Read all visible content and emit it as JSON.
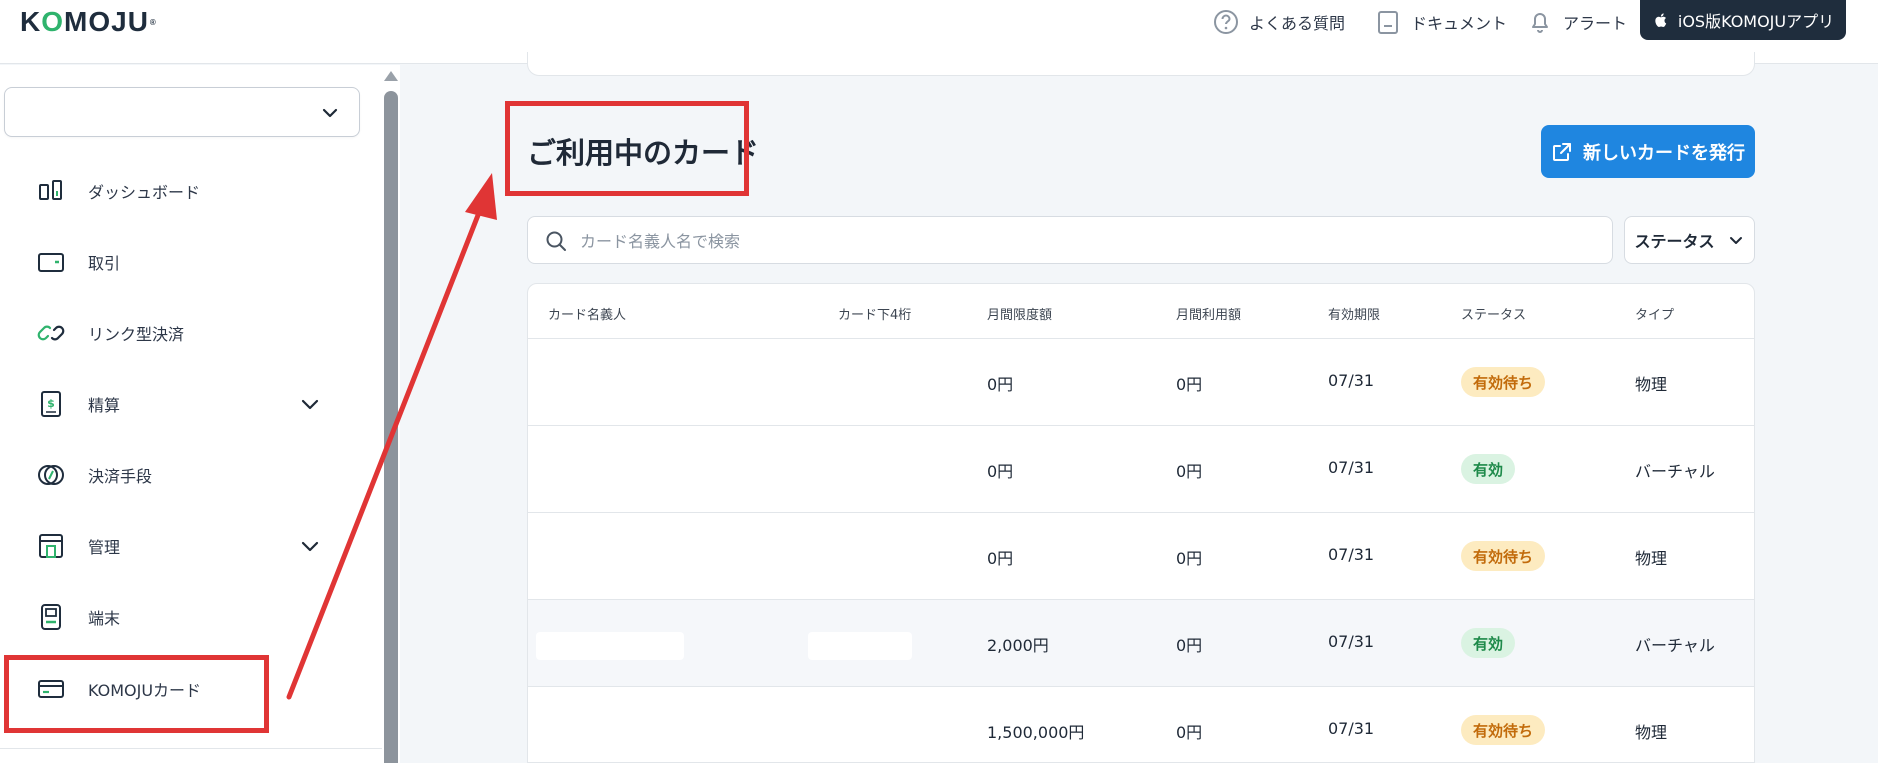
{
  "header": {
    "logo": "KOMOJU",
    "faq": "よくある質問",
    "docs": "ドキュメント",
    "alerts": "アラート",
    "ios_app": "iOS版KOMOJUアプリ"
  },
  "sidebar": {
    "account_value": "",
    "items": [
      {
        "label": "ダッシュボード",
        "icon": "dashboard-icon"
      },
      {
        "label": "取引",
        "icon": "wallet-icon"
      },
      {
        "label": "リンク型決済",
        "icon": "link-icon"
      },
      {
        "label": "精算",
        "icon": "settlement-icon",
        "expandable": true
      },
      {
        "label": "決済手段",
        "icon": "payment-methods-icon"
      },
      {
        "label": "管理",
        "icon": "store-icon",
        "expandable": true
      },
      {
        "label": "端末",
        "icon": "terminal-icon"
      },
      {
        "label": "KOMOJUカード",
        "icon": "card-icon"
      }
    ]
  },
  "main": {
    "title": "ご利用中のカード",
    "new_card_button": "新しいカードを発行",
    "search_placeholder": "カード名義人名で検索",
    "status_filter": "ステータス",
    "columns": [
      "カード名義人",
      "カード下4桁",
      "月間限度額",
      "月間利用額",
      "有効期限",
      "ステータス",
      "タイプ"
    ],
    "rows": [
      {
        "holder": "",
        "last4": "",
        "limit": "0円",
        "used": "0円",
        "expiry": "07/31",
        "status": "有効待ち",
        "status_kind": "pending",
        "type": "物理"
      },
      {
        "holder": "",
        "last4": "",
        "limit": "0円",
        "used": "0円",
        "expiry": "07/31",
        "status": "有効",
        "status_kind": "active",
        "type": "バーチャル"
      },
      {
        "holder": "",
        "last4": "",
        "limit": "0円",
        "used": "0円",
        "expiry": "07/31",
        "status": "有効待ち",
        "status_kind": "pending",
        "type": "物理"
      },
      {
        "holder": "",
        "last4": "",
        "limit": "2,000円",
        "used": "0円",
        "expiry": "07/31",
        "status": "有効",
        "status_kind": "active",
        "type": "バーチャル"
      },
      {
        "holder": "",
        "last4": "",
        "limit": "1,500,000円",
        "used": "0円",
        "expiry": "07/31",
        "status": "有効待ち",
        "status_kind": "pending",
        "type": "物理"
      }
    ]
  },
  "colors": {
    "brand_dark": "#1f2d3d",
    "brand_green": "#2fb36d",
    "primary_blue": "#1f86e0",
    "annotation_red": "#e03535",
    "pending_bg": "#fdebc0",
    "pending_fg": "#c26b0b",
    "active_bg": "#daf3e2",
    "active_fg": "#1e8a4a"
  }
}
